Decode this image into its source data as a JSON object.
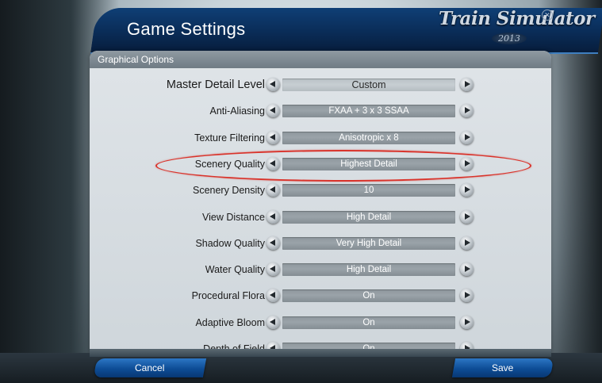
{
  "window": {
    "title": "Game Settings",
    "brand": "Train Simulator",
    "brand_year": "2013",
    "close_icon": "close-icon"
  },
  "panel": {
    "title": "Graphical Options"
  },
  "options": [
    {
      "label": "Master Detail Level",
      "value": "Custom"
    },
    {
      "label": "Anti-Aliasing",
      "value": "FXAA + 3 x 3 SSAA"
    },
    {
      "label": "Texture Filtering",
      "value": "Anisotropic x 8"
    },
    {
      "label": "Scenery Quality",
      "value": "Highest Detail"
    },
    {
      "label": "Scenery Density",
      "value": "10"
    },
    {
      "label": "View Distance",
      "value": "High Detail"
    },
    {
      "label": "Shadow Quality",
      "value": "Very High Detail"
    },
    {
      "label": "Water Quality",
      "value": "High Detail"
    },
    {
      "label": "Procedural Flora",
      "value": "On"
    },
    {
      "label": "Adaptive Bloom",
      "value": "On"
    },
    {
      "label": "Depth of Field",
      "value": "On"
    }
  ],
  "footer": {
    "cancel_label": "Cancel",
    "save_label": "Save"
  },
  "colors": {
    "accent_blue": "#0d4c95",
    "highlight_red": "#d9332b"
  }
}
